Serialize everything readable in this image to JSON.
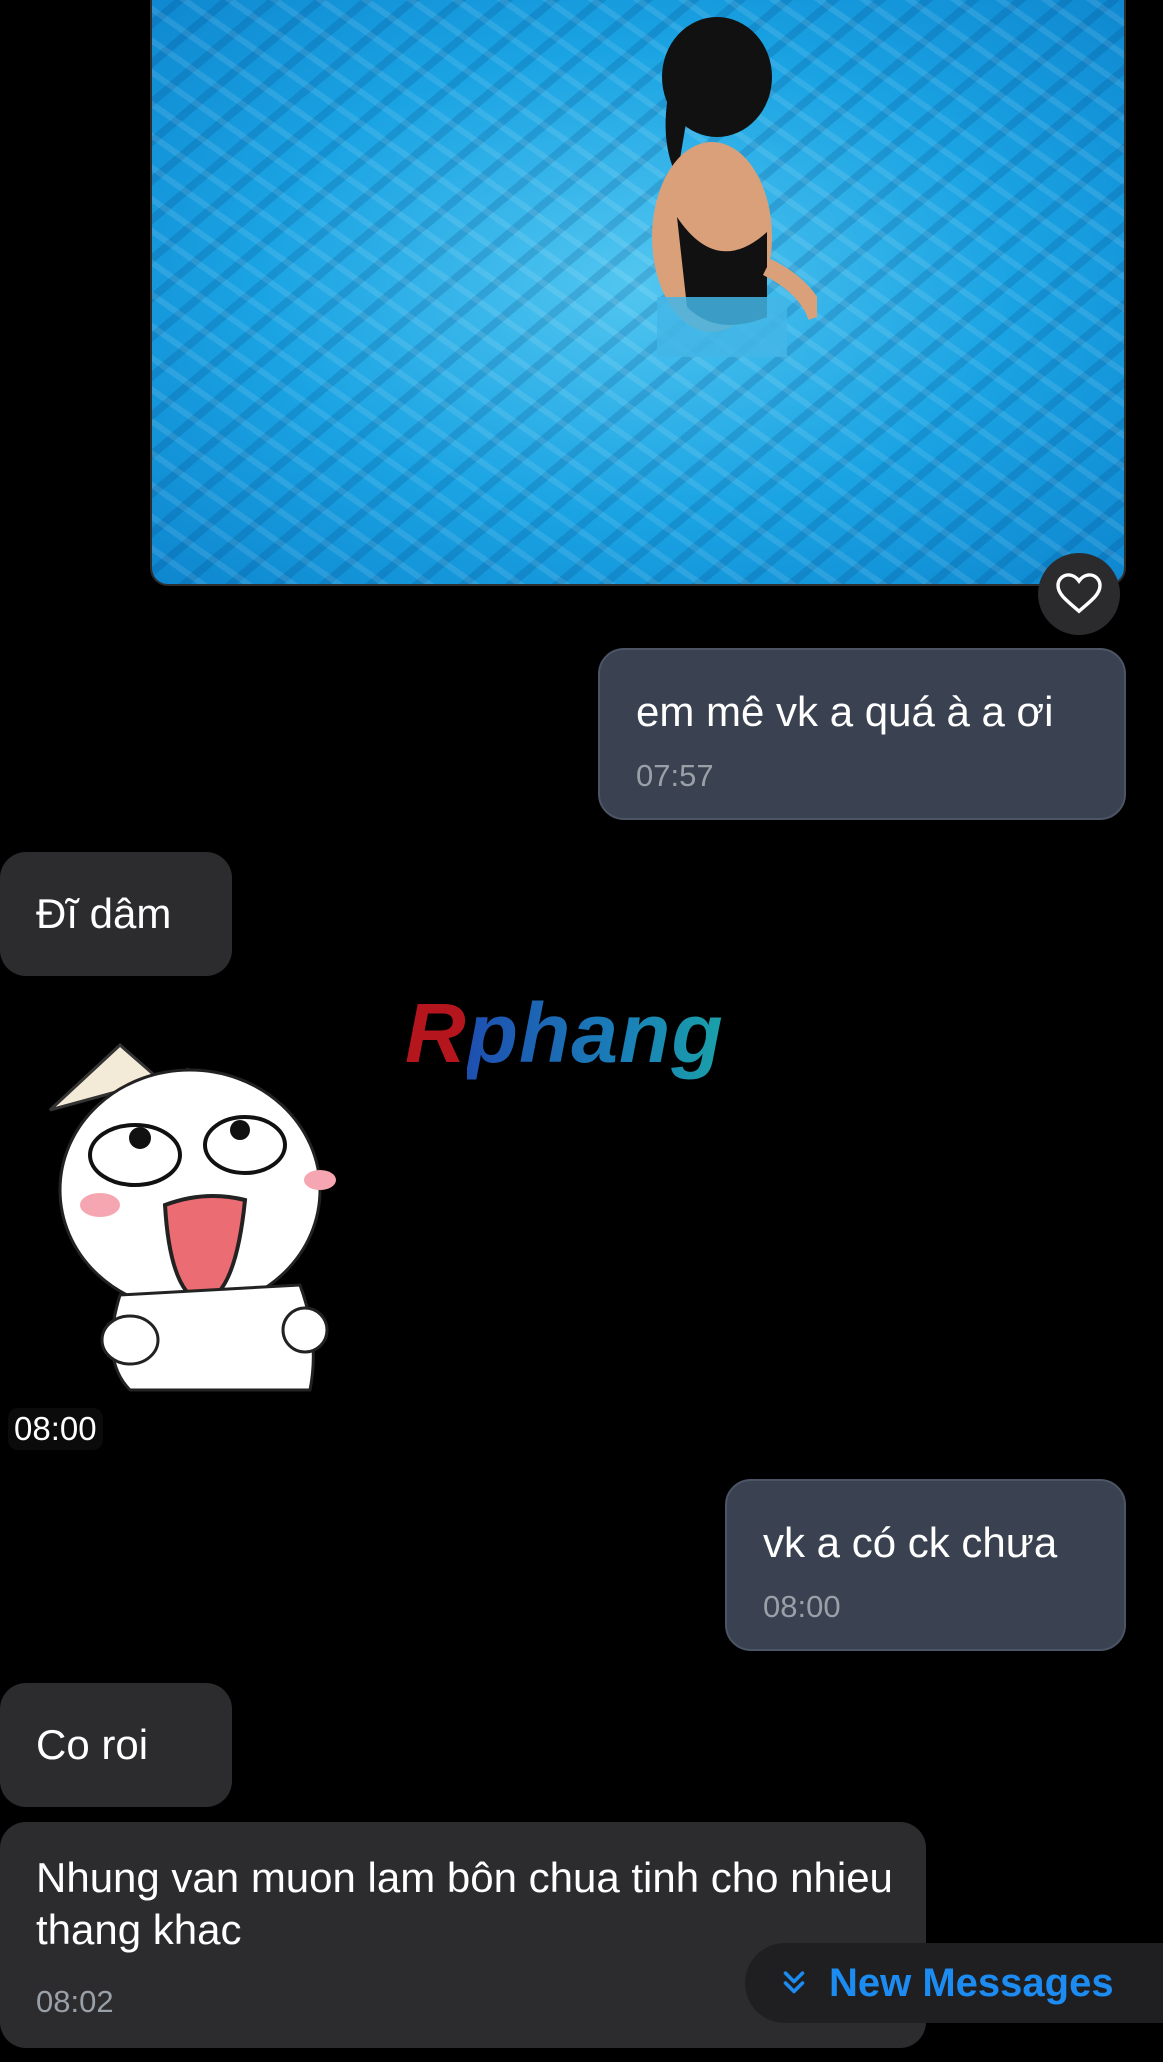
{
  "photo": {
    "alt": "pool photo",
    "like_icon": "heart-icon"
  },
  "messages": [
    {
      "dir": "out",
      "text": "em mê vk a quá à a ơi",
      "time": "07:57"
    },
    {
      "dir": "in",
      "text": "Đĩ dâm"
    },
    {
      "dir": "in",
      "sticker": "smiling-cat-sticker",
      "time": "08:00"
    },
    {
      "dir": "out",
      "text": "vk a có ck chưa",
      "time": "08:00"
    },
    {
      "dir": "in",
      "text": "Co roi"
    },
    {
      "dir": "in",
      "text": "Nhung van muon lam bôn chua tinh cho nhieu thang khac",
      "time": "08:02"
    }
  ],
  "watermark": {
    "first": "R",
    "rest": "phang"
  },
  "new_messages": {
    "label": "New Messages",
    "icon": "double-chevron-down-icon"
  },
  "colors": {
    "accent": "#1c8cf2",
    "outgoing_bubble": "#3a4150",
    "incoming_bubble": "#2c2c2e"
  }
}
